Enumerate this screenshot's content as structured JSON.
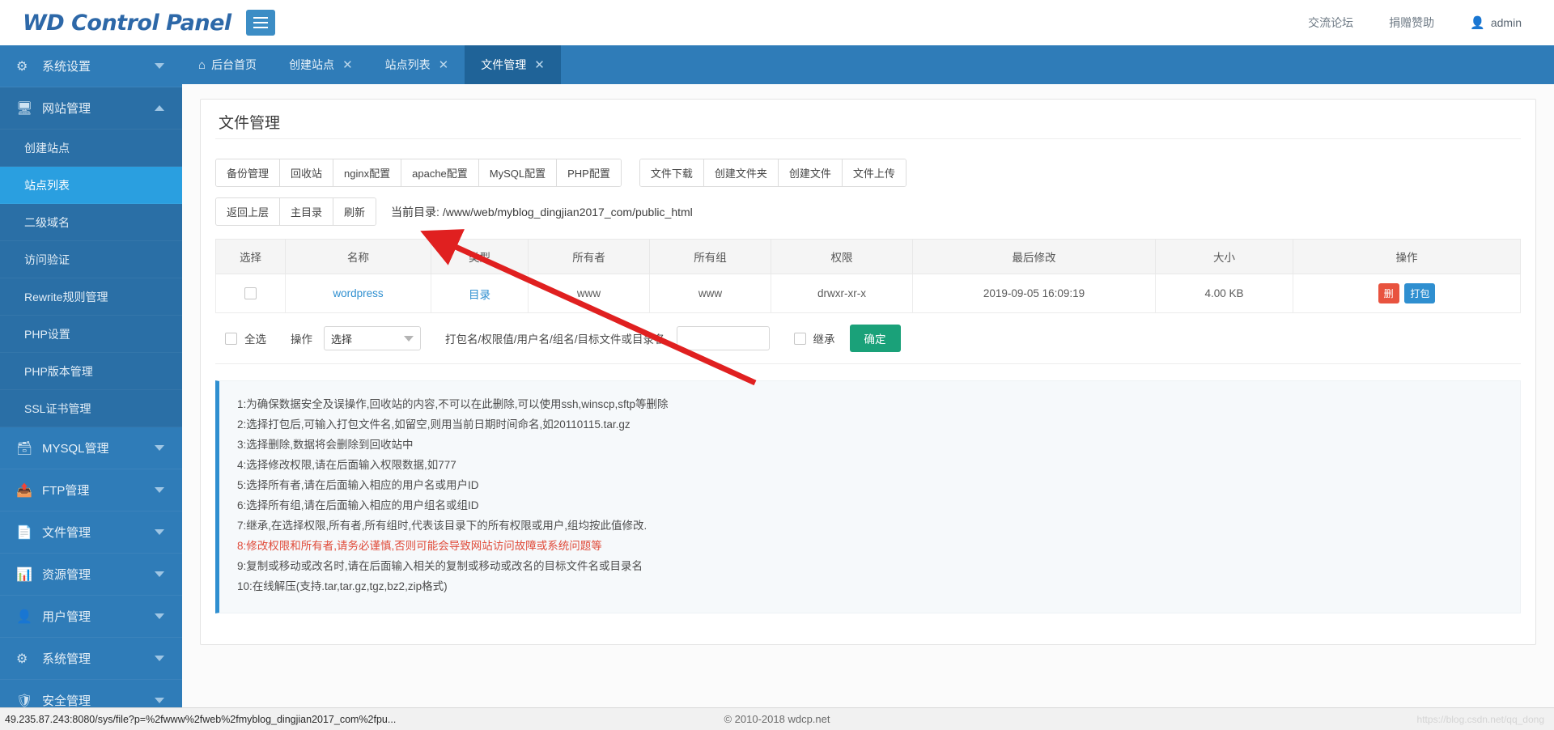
{
  "topbar": {
    "brand": "WD Control Panel",
    "menu_icon": "hamburger-icon",
    "links": [
      "交流论坛",
      "捐赠赞助"
    ],
    "user": "admin"
  },
  "sidebar": {
    "groups": [
      {
        "label": "系统设置",
        "icon": "gear-icon",
        "state": "collapsed",
        "active": false
      },
      {
        "label": "网站管理",
        "icon": "monitor-icon",
        "state": "expanded",
        "active": true
      },
      {
        "label": "MYSQL管理",
        "icon": "database-icon",
        "state": "collapsed",
        "active": false
      },
      {
        "label": "FTP管理",
        "icon": "ftp-icon",
        "state": "collapsed",
        "active": false
      },
      {
        "label": "文件管理",
        "icon": "file-icon",
        "state": "collapsed",
        "active": false
      },
      {
        "label": "资源管理",
        "icon": "resource-icon",
        "state": "collapsed",
        "active": false
      },
      {
        "label": "用户管理",
        "icon": "user-icon",
        "state": "collapsed",
        "active": false
      },
      {
        "label": "系统管理",
        "icon": "system-icon",
        "state": "collapsed",
        "active": false
      },
      {
        "label": "安全管理",
        "icon": "shield-icon",
        "state": "collapsed",
        "active": false
      }
    ],
    "website_subitems": [
      {
        "label": "创建站点",
        "active": false
      },
      {
        "label": "站点列表",
        "active": true
      },
      {
        "label": "二级域名",
        "active": false
      },
      {
        "label": "访问验证",
        "active": false
      },
      {
        "label": "Rewrite规则管理",
        "active": false
      },
      {
        "label": "PHP设置",
        "active": false
      },
      {
        "label": "PHP版本管理",
        "active": false
      },
      {
        "label": "SSL证书管理",
        "active": false
      }
    ]
  },
  "tabs": [
    {
      "label": "后台首页",
      "closable": false,
      "active": false,
      "icon": "home-icon"
    },
    {
      "label": "创建站点",
      "closable": true,
      "active": false
    },
    {
      "label": "站点列表",
      "closable": true,
      "active": false
    },
    {
      "label": "文件管理",
      "closable": true,
      "active": true
    }
  ],
  "panel": {
    "title": "文件管理",
    "toolbar_group_1": [
      "备份管理",
      "回收站",
      "nginx配置",
      "apache配置",
      "MySQL配置",
      "PHP配置"
    ],
    "toolbar_group_2": [
      "文件下载",
      "创建文件夹",
      "创建文件",
      "文件上传"
    ],
    "nav_buttons": [
      "返回上层",
      "主目录",
      "刷新"
    ],
    "current_dir_label": "当前目录:",
    "current_dir_path": "/www/web/myblog_dingjian2017_com/public_html"
  },
  "table": {
    "headers": [
      "选择",
      "名称",
      "类型",
      "所有者",
      "所有组",
      "权限",
      "最后修改",
      "大小",
      "操作"
    ],
    "rows": [
      {
        "checked": false,
        "name": "wordpress",
        "type": "目录",
        "owner": "www",
        "group": "www",
        "perm": "drwxr-xr-x",
        "modified": "2019-09-05 16:09:19",
        "size": "4.00 KB",
        "actions": [
          {
            "label": "删",
            "kind": "delete"
          },
          {
            "label": "打包",
            "kind": "pack"
          }
        ]
      }
    ]
  },
  "action_form": {
    "select_all_label": "全选",
    "operation_label": "操作",
    "select_value": "选择",
    "field_label": "打包名/权限值/用户名/组名/目标文件或目录名",
    "field_value": "",
    "inherit_label": "继承",
    "inherit_checked": false,
    "confirm_label": "确定"
  },
  "notes": [
    {
      "text": "1:为确保数据安全及误操作,回收站的内容,不可以在此删除,可以使用ssh,winscp,sftp等删除",
      "warn": false
    },
    {
      "text": "2:选择打包后,可输入打包文件名,如留空,则用当前日期时间命名,如20110115.tar.gz",
      "warn": false
    },
    {
      "text": "3:选择删除,数据将会删除到回收站中",
      "warn": false
    },
    {
      "text": "4:选择修改权限,请在后面输入权限数据,如777",
      "warn": false
    },
    {
      "text": "5:选择所有者,请在后面输入相应的用户名或用户ID",
      "warn": false
    },
    {
      "text": "6:选择所有组,请在后面输入相应的用户组名或组ID",
      "warn": false
    },
    {
      "text": "7:继承,在选择权限,所有者,所有组时,代表该目录下的所有权限或用户,组均按此值修改.",
      "warn": false
    },
    {
      "text": "8:修改权限和所有者,请务必谨慎,否则可能会导致网站访问故障或系统问题等",
      "warn": true
    },
    {
      "text": "9:复制或移动或改名时,请在后面输入相关的复制或移动或改名的目标文件名或目录名",
      "warn": false
    },
    {
      "text": "10:在线解压(支持.tar,tar.gz,tgz,bz2,zip格式)",
      "warn": false
    }
  ],
  "statusbar": {
    "url": "49.235.87.243:8080/sys/file?p=%2fwww%2fweb%2fmyblog_dingjian2017_com%2fpu...",
    "copyright": "© 2010-2018 wdcp.net",
    "watermark": "https://blog.csdn.net/qq_dong"
  },
  "colors": {
    "brand_blue": "#2d68a8",
    "sidebar_blue": "#2f7cb8",
    "sidebar_active": "#2a9fe0",
    "tab_active": "#1f6398",
    "link_blue": "#2f8fd0",
    "delete_red": "#e8533f",
    "confirm_green": "#1aa179",
    "warn_red": "#e04b3a",
    "annotation_arrow": "#e02020"
  }
}
